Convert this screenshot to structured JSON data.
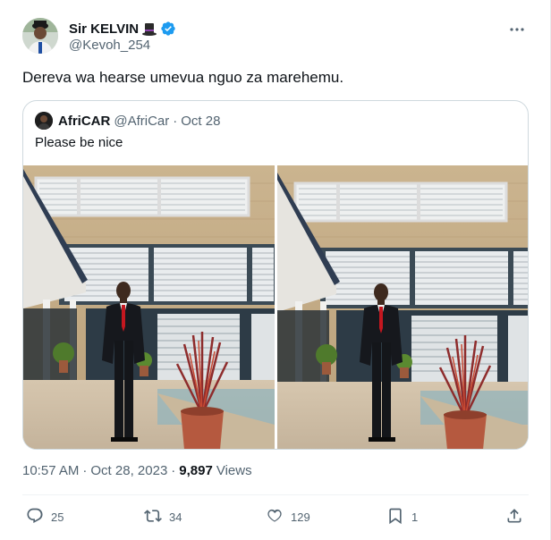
{
  "author": {
    "display_name": "Sir KELVIN",
    "handle": "@Kevoh_254",
    "badge_icon": "top-hat-icon",
    "verified_icon": "verified-badge-icon",
    "verified_color": "#1d9bf0"
  },
  "tweet": {
    "text": "Dereva wa hearse umevua nguo za marehemu."
  },
  "quoted": {
    "display_name": "AfriCAR",
    "handle": "@AfriCar",
    "separator": "·",
    "date": "Oct 28",
    "text": "Please be nice"
  },
  "meta": {
    "time": "10:57 AM",
    "separator": "·",
    "date": "Oct 28, 2023",
    "separator2": "·",
    "views_count": "9,897",
    "views_label": "Views"
  },
  "actions": {
    "replies": "25",
    "retweets": "34",
    "likes": "129",
    "bookmarks": "1"
  },
  "colors": {
    "text_primary": "#0f1419",
    "text_secondary": "#536471",
    "border": "#cfd9de",
    "accent": "#1d9bf0"
  }
}
